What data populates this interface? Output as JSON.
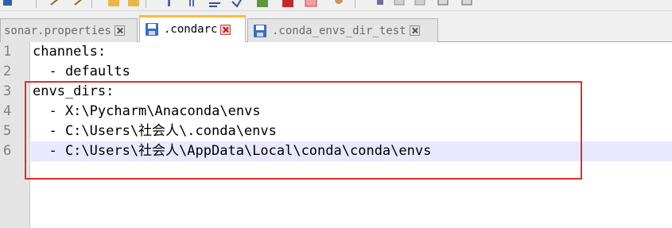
{
  "toolbar": {
    "icons": [
      "save-all-icon",
      "undo-icon",
      "redo-icon",
      "cut-icon",
      "paste-icon",
      "outdent-icon",
      "indent-icon",
      "wrap-icon",
      "find-icon",
      "bookmark-icon",
      "color-icon",
      "highlight-icon",
      "zoom-icon",
      "macro-icon",
      "play-icon",
      "window-icon",
      "tools-icon"
    ]
  },
  "tabs": [
    {
      "label": "sonar.properties",
      "active": false,
      "close_color": "gray"
    },
    {
      "label": ".condarc",
      "active": true,
      "close_color": "red"
    },
    {
      "label": ".conda_envs_dir_test",
      "active": false,
      "close_color": "gray"
    }
  ],
  "editor": {
    "line_numbers": [
      "1",
      "2",
      "3",
      "4",
      "5",
      "6"
    ],
    "lines": [
      "channels:",
      "  - defaults",
      "envs_dirs:",
      "  - X:\\Pycharm\\Anaconda\\envs",
      "  - C:\\Users\\社会人\\.conda\\envs",
      "  - C:\\Users\\社会人\\AppData\\Local\\conda\\conda\\envs"
    ],
    "current_line": 6
  },
  "colors": {
    "annotation_box": "#e03030",
    "active_tab_accent": "#fabd3c",
    "current_line_bg": "#e8e8ff"
  }
}
